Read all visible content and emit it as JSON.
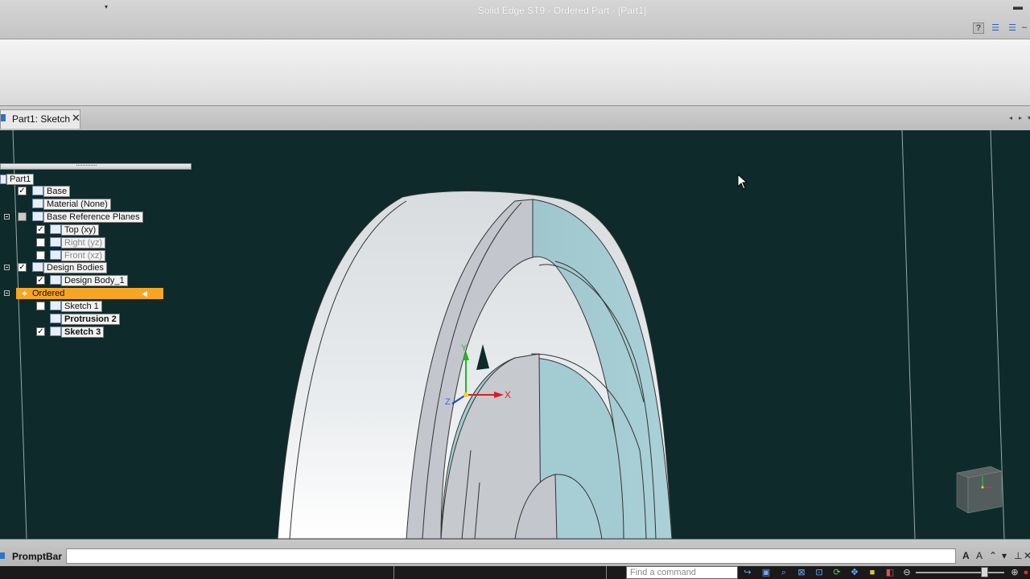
{
  "app": {
    "title": "Solid Edge ST9 - Ordered Part - [Part1]",
    "quick_access_arrow": "▾",
    "minimize_glyph": "▬",
    "help_glyph": "?",
    "ribbon_minimize_glyph": "–"
  },
  "document_tab": {
    "label": "Part1: Sketch",
    "close_glyph": "✕",
    "scroll_left": "◂",
    "scroll_right": "▸",
    "menu_glyph": "▾"
  },
  "pathfinder": {
    "grip": "·············",
    "nodes": {
      "part": "Part1",
      "base": "Base",
      "material": "Material (None)",
      "base_reference_planes": "Base Reference Planes",
      "top": "Top (xy)",
      "right": "Right (yz)",
      "front": "Front (xz)",
      "design_bodies": "Design Bodies",
      "design_body_1": "Design Body_1",
      "ordered": "Ordered",
      "sketch_1": "Sketch 1",
      "protrusion_2": "Protrusion 2",
      "sketch_3": "Sketch 3"
    },
    "checked_glyph": "✓",
    "collapse_glyph": "−"
  },
  "triad": {
    "x_label": "X",
    "y_label": "Y",
    "z_label": "Z"
  },
  "colors": {
    "viewport_bg": "#0e2a2b",
    "ordered_highlight": "#f7a623",
    "axis_x": "#e02020",
    "axis_y": "#20c020",
    "axis_z": "#2040e0"
  },
  "promptbar": {
    "label": "PromptBar",
    "value": ""
  },
  "statusbar": {
    "find_command_placeholder": "Find a command"
  }
}
